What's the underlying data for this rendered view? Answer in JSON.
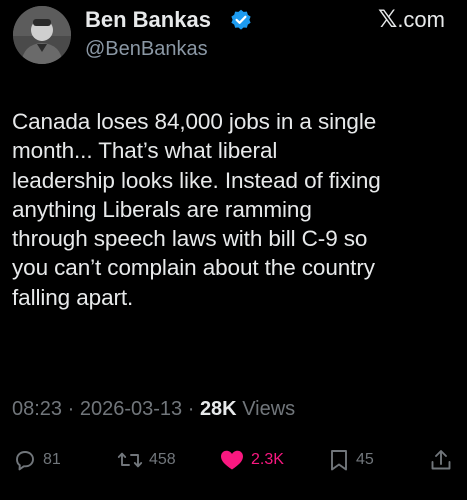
{
  "author": {
    "name": "Ben Bankas",
    "handle": "@BenBankas",
    "verified": true,
    "avatar_icon": "person-avatar"
  },
  "site": {
    "x_glyph": "𝕏",
    "domain": ".com"
  },
  "tweet": {
    "lines": [
      "Canada loses 84,000 jobs in a single",
      "month... That’s what liberal",
      "leadership looks like. Instead of fixing",
      "anything Liberals are ramming",
      "through speech laws with bill C-9 so",
      "you can’t complain about the country",
      "falling apart."
    ]
  },
  "meta": {
    "time": "08:23",
    "separator": " · ",
    "date": "2026-03-13",
    "views_count": "28K",
    "views_label": " Views"
  },
  "actions": {
    "replies": "81",
    "reposts": "458",
    "likes": "2.3K",
    "bookmarks": "45"
  },
  "colors": {
    "background": "#000000",
    "text": "#e7e9ea",
    "secondary": "#71767b",
    "verified": "#1d9bf0",
    "like": "#f91880"
  }
}
